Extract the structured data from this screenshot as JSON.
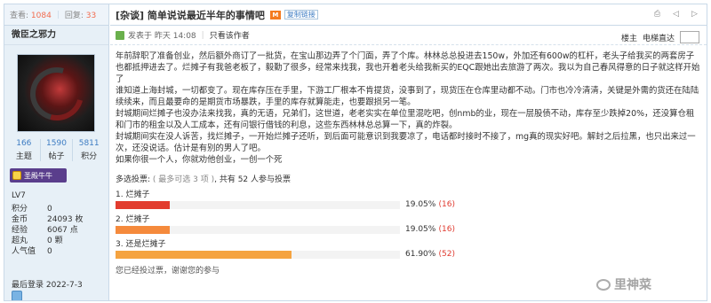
{
  "side": {
    "views_label": "查看:",
    "views": "1084",
    "replies_label": "回复:",
    "replies": "33",
    "username": "微臣之邪力",
    "counts": [
      {
        "value": "166",
        "label": "主题"
      },
      {
        "value": "1590",
        "label": "帖子"
      },
      {
        "value": "5811",
        "label": "积分"
      }
    ],
    "badge": "圣殿牛牛",
    "level": "LV7",
    "info": [
      {
        "k": "积分",
        "v": "0"
      },
      {
        "k": "金币",
        "v": "24093 枚"
      },
      {
        "k": "经验",
        "v": "6067 点"
      },
      {
        "k": "超丸",
        "v": "0 颗"
      },
      {
        "k": "人气值",
        "v": "0"
      }
    ],
    "last_login": "最后登录  2022-7-3"
  },
  "post": {
    "category": "[杂谈]",
    "title": "简单说说最近半年的事情吧",
    "copy_link": "复制链接",
    "posted_at": "发表于 昨天 14:08",
    "only_author": "只看该作者",
    "floor": "楼主",
    "jump": "电梯直达",
    "paragraphs": [
      "年前辞职了准备创业，然后额外商订了一批货，在宝山那边弄了个门面，弄了个库。林林总总投进去150w，外加还有600w的杠杆，老头子给我买的两套房子也都抵押进去了。烂摊子有我爸老板了，毅勤了很多，经常来找我，我也开着老头给我新买的EQC跟她出去旅游了两次。我以为自己春风得意的日子就这样开始了",
      "谁知道上海封城，一切都变了。现在库存压在手里，下游工厂根本不肯提货，没事到了，现货压在仓库里动都不动。门市也冷冷清清，关键是外需的货还在陆陆续续来，而且最要命的是期货市场暴跌，手里的库存就算能走，也要跟损另一笔。",
      "封城期间烂摊子也没办法来找我，真的无语，兄弟们，这世道，老老实实在单位里混吃吧，创nmb的业，现在一层股债不动，库存至少跌掉20%，还没算仓租和门市的租金以及人工成本，还有问银行借钱的利息，这些东西林林总总算一下，真的炸裂。",
      "封城期间实在没人诉苦，找烂摊子，一开始烂摊子还听，到后面可能意识到我要凉了，电话都时接时不接了，mg真的现实好吧。解封之后拉黑，也只出来过一次，还没说话。估计是有别的男人了吧。",
      "如果你很一个人，你就劝他创业，一创一个死"
    ]
  },
  "poll": {
    "head": "多选投票:",
    "head_muted": "( 最多可选 3 项 )",
    "head_tail": ", 共有 52 人参与投票",
    "options": [
      {
        "label": "1. 烂摊子",
        "pct": "19.05%",
        "count": "(16)",
        "value": 19.05,
        "color": "#e23c2e"
      },
      {
        "label": "2. 烂摊子",
        "pct": "19.05%",
        "count": "(16)",
        "value": 19.05,
        "color": "#f58a3c"
      },
      {
        "label": "3. 还是烂摊子",
        "pct": "61.90%",
        "count": "(52)",
        "value": 61.9,
        "color": "#f5a340"
      }
    ],
    "voted": "您已经投过票，谢谢您的参与"
  },
  "watermark": "里神菜"
}
